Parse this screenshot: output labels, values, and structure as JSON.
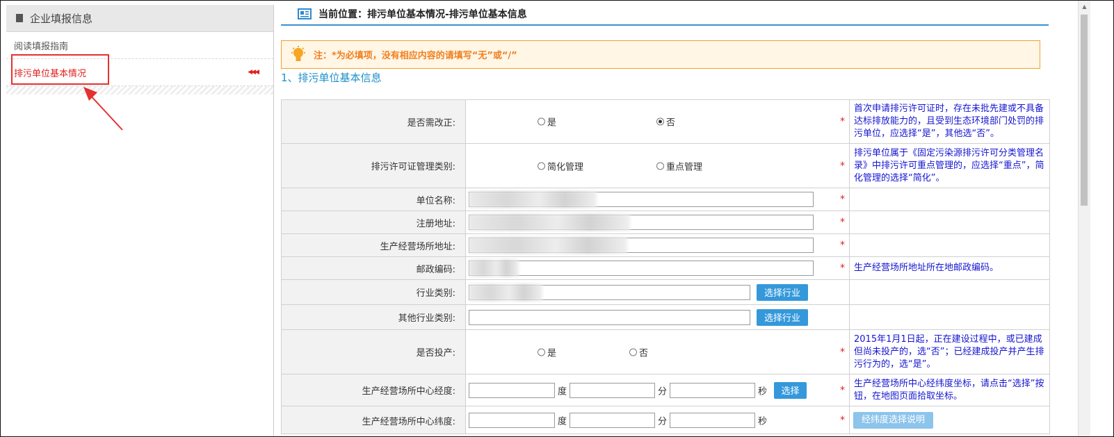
{
  "sidebar": {
    "title": "企业填报信息",
    "items": [
      {
        "label": "阅读填报指南"
      },
      {
        "label": "排污单位基本情况"
      }
    ]
  },
  "breadcrumb": "当前位置：排污单位基本情况-排污单位基本信息",
  "notice": "注：*为必填项，没有相应内容的请填写“无”或“/”",
  "section_title": "1、排污单位基本信息",
  "required_mark": "*",
  "form": {
    "need_rectify": {
      "label": "是否需改正:",
      "options": [
        "是",
        "否"
      ],
      "selected": "否",
      "tip": "首次申请排污许可证时，存在未批先建或不具备达标排放能力的，且受到生态环境部门处罚的排污单位，应选择“是”，其他选“否”。"
    },
    "mgmt_category": {
      "label": "排污许可证管理类别:",
      "options": [
        "简化管理",
        "重点管理"
      ],
      "tip": "排污单位属于《固定污染源排污许可分类管理名录》中排污许可重点管理的，应选择“重点”，简化管理的选择“简化”。"
    },
    "unit_name": {
      "label": "单位名称:"
    },
    "reg_address": {
      "label": "注册地址:"
    },
    "prod_address": {
      "label": "生产经营场所地址:"
    },
    "postal_code": {
      "label": "邮政编码:",
      "tip": "生产经营场所地址所在地邮政编码。"
    },
    "industry": {
      "label": "行业类别:",
      "button": "选择行业"
    },
    "other_industry": {
      "label": "其他行业类别:",
      "button": "选择行业"
    },
    "in_production": {
      "label": "是否投产:",
      "options": [
        "是",
        "否"
      ],
      "tip": "2015年1月1日起，正在建设过程中，或已建成但尚未投产的，选“否”；已经建成投产并产生排污行为的，选“是”。"
    },
    "center_longitude": {
      "label": "生产经营场所中心经度:",
      "units": [
        "度",
        "分",
        "秒"
      ],
      "button": "选择",
      "tip": "生产经营场所中心经纬度坐标，请点击“选择”按钮，在地图页面拾取坐标。"
    },
    "center_latitude": {
      "label": "生产经营场所中心纬度:",
      "units": [
        "度",
        "分",
        "秒"
      ],
      "button": "经纬度选择说明"
    }
  }
}
